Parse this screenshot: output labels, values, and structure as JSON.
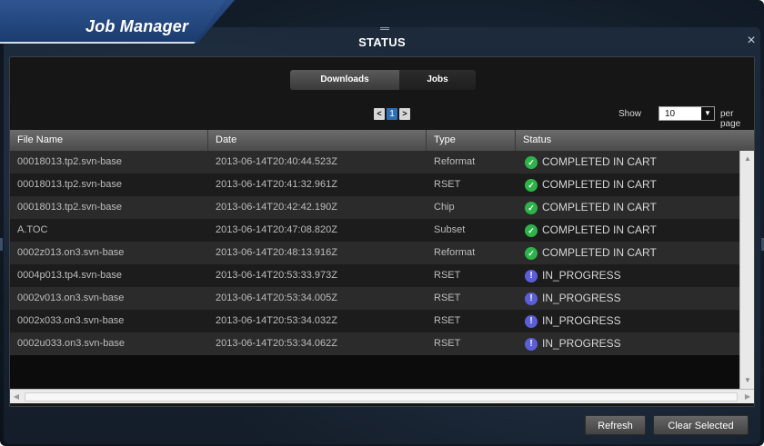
{
  "window": {
    "tab_label": "Job Manager",
    "title": "STATUS",
    "close_glyph": "×"
  },
  "tabs": [
    {
      "label": "Downloads",
      "active": true
    },
    {
      "label": "Jobs",
      "active": false
    }
  ],
  "pager": {
    "prev": "<",
    "current": "1",
    "next": ">"
  },
  "page_size": {
    "show_label": "Show",
    "value": "10",
    "per_page_label": "per page"
  },
  "grid": {
    "columns": [
      "File Name",
      "Date",
      "Type",
      "Status"
    ],
    "rows": [
      {
        "file": "00018013.tp2.svn-base",
        "date": "2013-06-14T20:40:44.523Z",
        "type": "Reformat",
        "status": "COMPLETED IN CART",
        "state": "complete"
      },
      {
        "file": "00018013.tp2.svn-base",
        "date": "2013-06-14T20:41:32.961Z",
        "type": "RSET",
        "status": "COMPLETED IN CART",
        "state": "complete"
      },
      {
        "file": "00018013.tp2.svn-base",
        "date": "2013-06-14T20:42:42.190Z",
        "type": "Chip",
        "status": "COMPLETED IN CART",
        "state": "complete"
      },
      {
        "file": "A.TOC",
        "date": "2013-06-14T20:47:08.820Z",
        "type": "Subset",
        "status": "COMPLETED IN CART",
        "state": "complete"
      },
      {
        "file": "0002z013.on3.svn-base",
        "date": "2013-06-14T20:48:13.916Z",
        "type": "Reformat",
        "status": "COMPLETED IN CART",
        "state": "complete"
      },
      {
        "file": "0004p013.tp4.svn-base",
        "date": "2013-06-14T20:53:33.973Z",
        "type": "RSET",
        "status": "IN_PROGRESS",
        "state": "progress"
      },
      {
        "file": "0002v013.on3.svn-base",
        "date": "2013-06-14T20:53:34.005Z",
        "type": "RSET",
        "status": "IN_PROGRESS",
        "state": "progress"
      },
      {
        "file": "0002x033.on3.svn-base",
        "date": "2013-06-14T20:53:34.032Z",
        "type": "RSET",
        "status": "IN_PROGRESS",
        "state": "progress"
      },
      {
        "file": "0002u033.on3.svn-base",
        "date": "2013-06-14T20:53:34.062Z",
        "type": "RSET",
        "status": "IN_PROGRESS",
        "state": "progress"
      }
    ]
  },
  "buttons": {
    "refresh": "Refresh",
    "clear_selected": "Clear Selected"
  },
  "icons": {
    "complete": "check-circle-icon",
    "progress": "info-circle-icon"
  },
  "colors": {
    "complete": "#2db34a",
    "progress": "#5c5ed8",
    "accent": "#2d6fb8"
  }
}
